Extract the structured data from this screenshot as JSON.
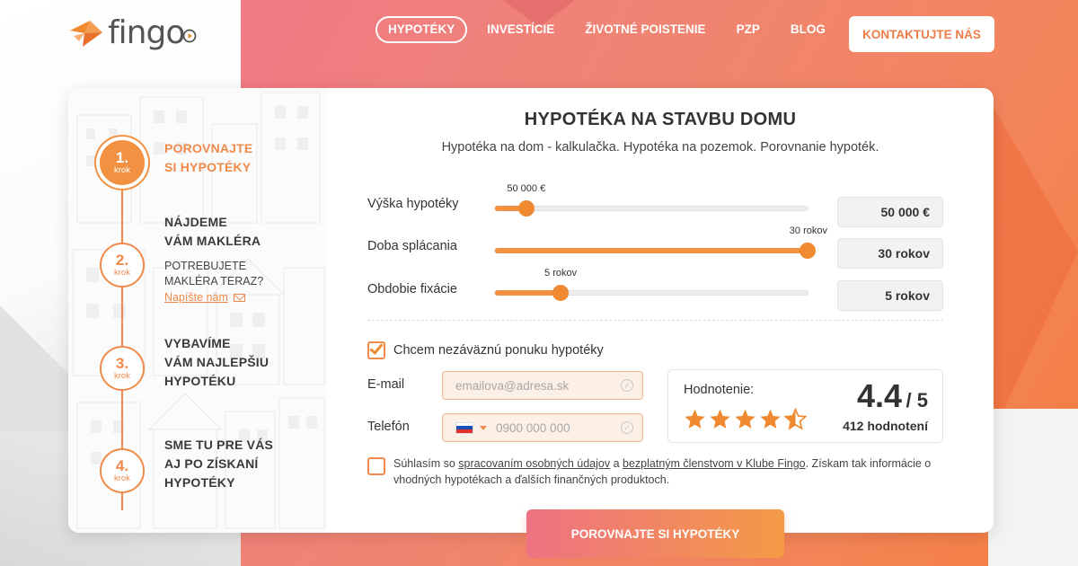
{
  "logo": {
    "text": "fingo"
  },
  "nav": {
    "items": [
      {
        "label": "HYPOTÉKY",
        "active": true
      },
      {
        "label": "INVESTÍCIE"
      },
      {
        "label": "ŽIVOTNÉ POISTENIE"
      },
      {
        "label": "PZP"
      },
      {
        "label": "BLOG"
      }
    ],
    "cta": "KONTAKTUJTE NÁS"
  },
  "steps": {
    "krok": "krok",
    "items": [
      {
        "num": "1.",
        "title_line1": "POROVNAJTE",
        "title_line2": "SI HYPOTÉKY"
      },
      {
        "num": "2.",
        "title_line1": "NÁJDEME",
        "title_line2": "VÁM MAKLÉRA",
        "note_line1": "POTREBUJETE",
        "note_line2": "MAKLÉRA TERAZ?",
        "link": "Napíšte nám"
      },
      {
        "num": "3.",
        "title_line1": "VYBAVÍME",
        "title_line2": "VÁM NAJLEPŠIU",
        "title_line3": "HYPOTÉKU"
      },
      {
        "num": "4.",
        "title_line1": "SME TU PRE VÁS",
        "title_line2": "AJ PO ZÍSKANÍ",
        "title_line3": "HYPOTÉKY"
      }
    ]
  },
  "form": {
    "title": "HYPOTÉKA NA STAVBU DOMU",
    "subtitle": "Hypotéka na dom - kalkulačka. Hypotéka na pozemok. Porovnanie hypoték.",
    "sliders": [
      {
        "label": "Výška hypotéky",
        "tooltip": "50 000 €",
        "value": "50 000 €",
        "level": 0.1
      },
      {
        "label": "Doba splácania",
        "tooltip": "30 rokov",
        "value": "30 rokov",
        "level": 1.0
      },
      {
        "label": "Obdobie fixácie",
        "tooltip": "5 rokov",
        "value": "5 rokov",
        "level": 0.21
      }
    ],
    "offer_checkbox": {
      "label": "Chcem nezáväznú ponuku hypotéky",
      "checked": true
    },
    "email": {
      "label": "E-mail",
      "placeholder": "emailova@adresa.sk"
    },
    "phone": {
      "label": "Telefón",
      "placeholder": "0900 000 000"
    },
    "consent": {
      "checked": false,
      "prefix": "Súhlasím so ",
      "link1": "spracovaním osobných údajov",
      "middle": " a ",
      "link2": "bezplatným členstvom v Klube Fingo",
      "suffix": ". Získam tak informácie o vhodných hypotékach a ďalších finančných produktoch."
    },
    "submit": "POROVNAJTE SI HYPOTÉKY"
  },
  "rating": {
    "label": "Hodnotenie:",
    "score": "4.4",
    "out_of": "/ 5",
    "count": "412 hodnotení",
    "stars": 4.5
  },
  "colors": {
    "accent": "#f08a4b",
    "brand_gradient_start": "#ee7282",
    "brand_gradient_end": "#f49a45"
  }
}
